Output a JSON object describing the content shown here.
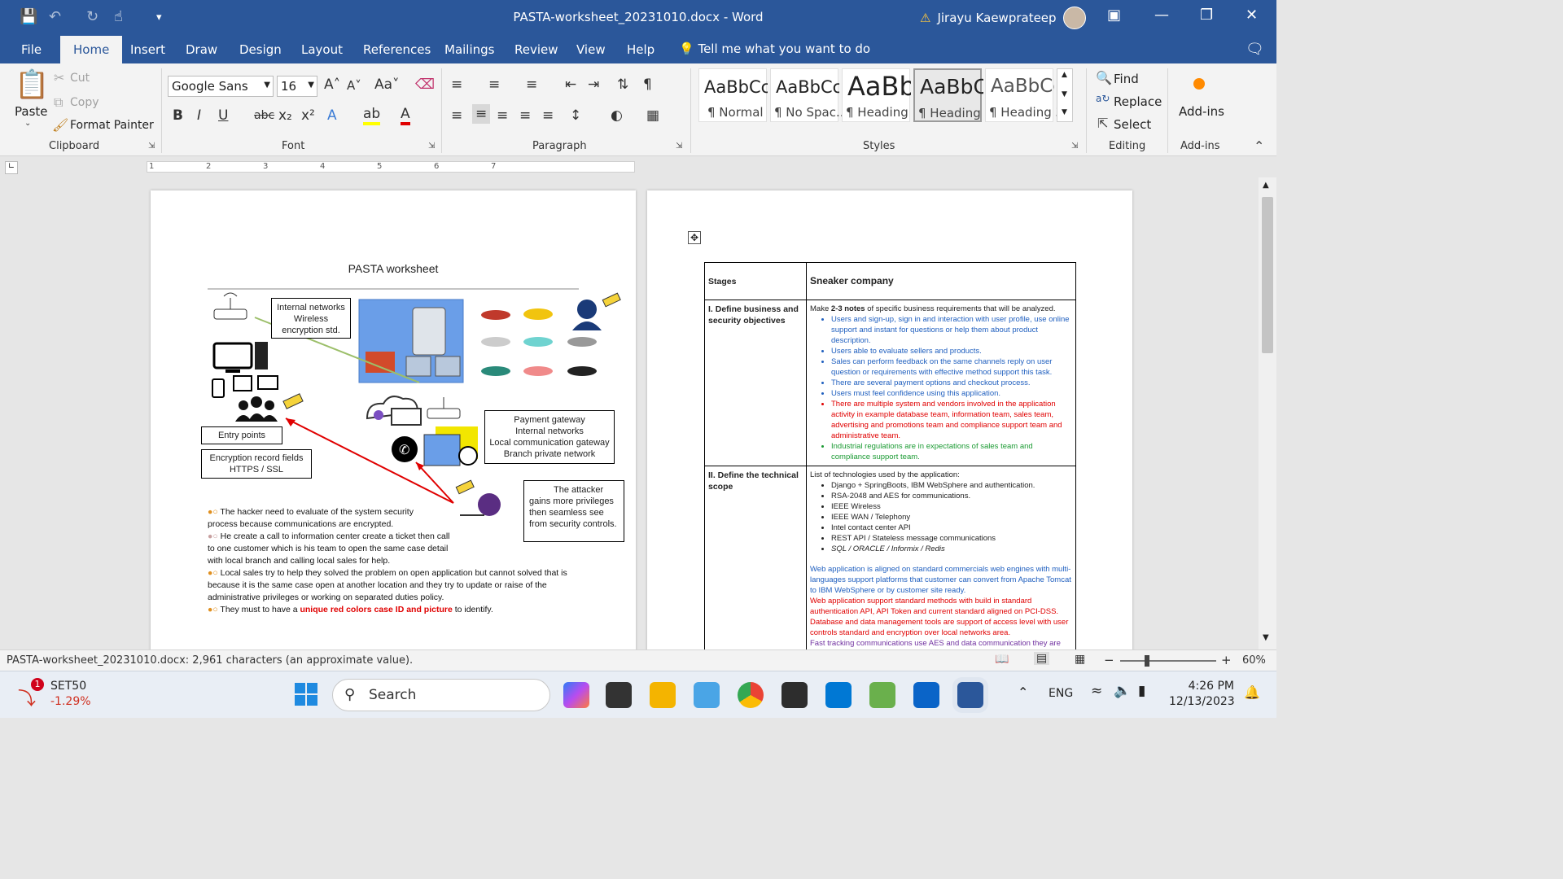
{
  "title": {
    "file": "PASTA-worksheet_20231010.docx",
    "app": "Word",
    "user": "Jirayu Kaewprateep"
  },
  "menu": [
    {
      "label": "File"
    },
    {
      "label": "Home"
    },
    {
      "label": "Insert"
    },
    {
      "label": "Draw"
    },
    {
      "label": "Design"
    },
    {
      "label": "Layout"
    },
    {
      "label": "References"
    },
    {
      "label": "Mailings"
    },
    {
      "label": "Review"
    },
    {
      "label": "View"
    },
    {
      "label": "Help"
    }
  ],
  "tell": "Tell me what you want to do",
  "clipboard": {
    "paste": "Paste",
    "cut": "Cut",
    "copy": "Copy",
    "format_painter": "Format Painter",
    "label": "Clipboard"
  },
  "font": {
    "name": "Google Sans",
    "size": "16",
    "label": "Font"
  },
  "paragraph_label": "Paragraph",
  "styles": {
    "items": [
      {
        "preview": "AaBbCcD",
        "name": "¶ Normal"
      },
      {
        "preview": "AaBbCcD",
        "name": "¶ No Spac..."
      },
      {
        "preview": "AaBb",
        "name": "¶ Heading 1"
      },
      {
        "preview": "AaBbC",
        "name": "¶ Heading 2"
      },
      {
        "preview": "AaBbCc",
        "name": "¶ Heading 3"
      }
    ],
    "label": "Styles"
  },
  "editing": {
    "find": "Find",
    "replace": "Replace",
    "select": "Select",
    "label": "Editing"
  },
  "addins": {
    "button": "Add-ins",
    "label": "Add-ins"
  },
  "page1": {
    "title": "PASTA worksheet",
    "box_internal": [
      "Internal networks",
      "Wireless",
      "encryption std."
    ],
    "box_entry": "Entry points",
    "box_encrypt": [
      "Encryption record fields",
      "HTTPS / SSL"
    ],
    "box_payment": [
      "Payment gateway",
      "Internal networks",
      "Local communication gateway",
      "Branch private network"
    ],
    "box_attacker": [
      "The attacker",
      "gains more privileges",
      "then seamless see",
      "from security controls."
    ],
    "story": [
      "The hacker need to evaluate of the system security process because communications are encrypted.",
      "He create a call to information center create a ticket then call to one customer which is his team to open the same case detail with local branch and calling local sales for help.",
      "Local sales try to help they solved the problem on open application but cannot solved that is because it is the same case open at another location and they try to update or raise of the administrative privileges or working on separated duties policy."
    ],
    "story_last_a": "They must to have a ",
    "story_last_b": "unique red colors case ID and picture",
    "story_last_c": " to identify."
  },
  "page2": {
    "head_stages": "Stages",
    "head_company": "Sneaker company",
    "row1_label": "I. Define business and security objectives",
    "row1_intro_a": "Make ",
    "row1_intro_b": "2-3 notes",
    "row1_intro_c": " of specific business requirements that will be analyzed.",
    "row1_items": [
      {
        "t": "Users and sign-up, sign in and interaction with user profile, use online support and instant for questions or help them about product description.",
        "c": "blue"
      },
      {
        "t": "Users able to evaluate sellers and products.",
        "c": "blue"
      },
      {
        "t": "Sales can perform feedback on the same channels reply on user question or requirements with effective method support this task.",
        "c": "blue"
      },
      {
        "t": "There are several payment options and checkout process.",
        "c": "blue"
      },
      {
        "t": "Users must feel confidence using this application.",
        "c": "blue"
      },
      {
        "t": "There are multiple system and vendors involved in the application activity in example database team, information team, sales team, advertising and promotions team and compliance support team and administrative team.",
        "c": "red2"
      },
      {
        "t": "Industrial regulations are in expectations of sales team and compliance support team.",
        "c": "green"
      }
    ],
    "row2_label": "II. Define the technical scope",
    "row2_intro": "List of technologies used by the application:",
    "row2_items": [
      "Django + SpringBoots, IBM WebSphere and authentication.",
      "RSA-2048 and AES for communications.",
      "IEEE Wireless",
      "IEEE WAN / Telephony",
      "Intel contact center API",
      "REST API / Stateless message communications",
      "SQL / ORACLE / Informix / Redis"
    ],
    "row2_p_blue": "Web application is aligned on standard commercials web engines with multi-languages support platforms that customer can convert from Apache Tomcat to IBM WebSphere or by customer site ready.",
    "row2_p_red": "Web application support standard methods with build in standard authentication API, API Token and current standard aligned on PCI-DSS. Database and data management tools are support of access level with user controls standard and encryption over local networks area.",
    "row2_p_pink": "Fast tracking communications use AES and data communication they are"
  },
  "status": {
    "words": "PASTA-worksheet_20231010.docx: 2,961 characters (an approximate value).",
    "zoom": "60%"
  },
  "taskbar": {
    "ticker": "SET50",
    "change": "-1.29%",
    "badge": "1",
    "search": "Search",
    "lang": "ENG",
    "time": "4:26 PM",
    "date": "12/13/2023"
  },
  "colors": {
    "word_blue": "#2b579a",
    "accent_red": "#e00000",
    "link_blue": "#1f5fbf"
  }
}
